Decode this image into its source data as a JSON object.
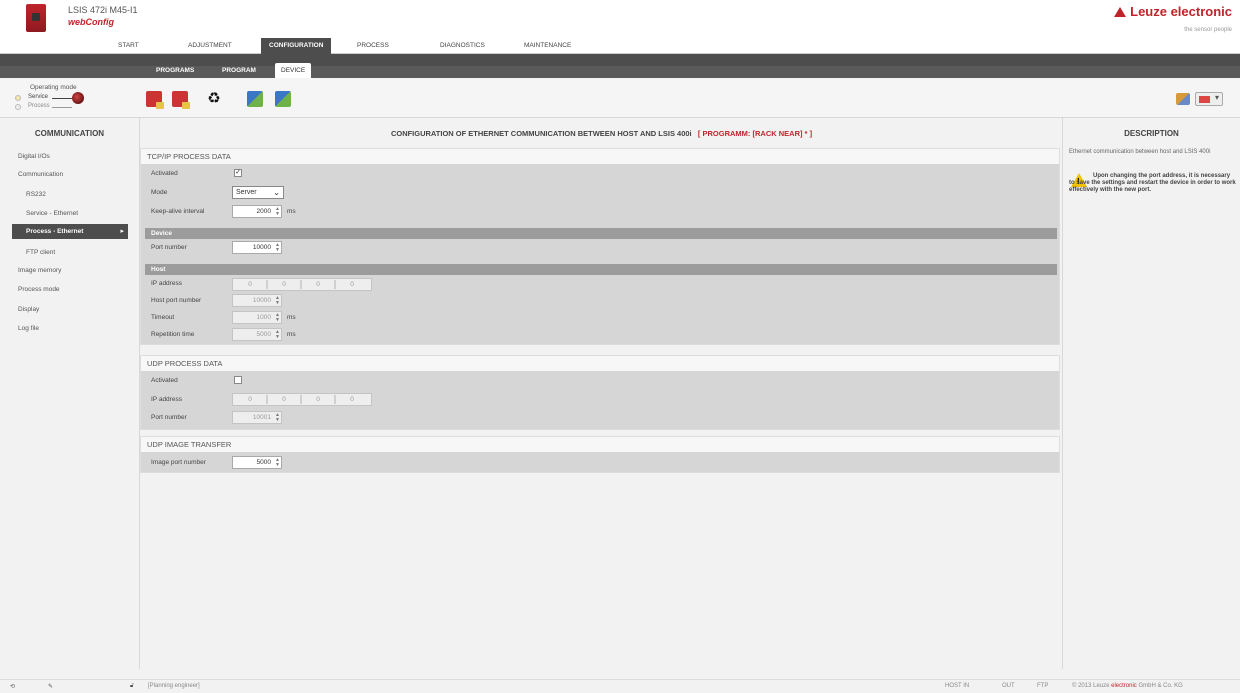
{
  "header": {
    "device_title": "LSIS 472i M45-I1",
    "app_name": "webConfig",
    "brand": "Leuze electronic",
    "tagline": "the sensor people"
  },
  "main_nav": [
    "START",
    "ADJUSTMENT",
    "CONFIGURATION",
    "PROCESS",
    "DIAGNOSTICS",
    "MAINTENANCE"
  ],
  "sub_nav": [
    "PROGRAMS",
    "PROGRAM",
    "DEVICE"
  ],
  "operating_mode": {
    "label": "Operating mode",
    "service": "Service",
    "process": "Process"
  },
  "sidebar": {
    "title": "COMMUNICATION",
    "items": [
      "Digital I/Os",
      "Communication",
      "RS232",
      "Service - Ethernet",
      "Process - Ethernet",
      "FTP client",
      "Image memory",
      "Process mode",
      "Display",
      "Log file"
    ]
  },
  "main": {
    "title": "CONFIGURATION OF ETHERNET COMMUNICATION BETWEEN HOST AND LSIS 400i",
    "program_ref": "[ PROGRAMM: [RACK NEAR] * ]",
    "tcpip": {
      "title": "TCP/IP PROCESS DATA",
      "activated_label": "Activated",
      "activated_mark": "✓",
      "mode_label": "Mode",
      "mode_value": "Server",
      "keepalive_label": "Keep-alive interval",
      "keepalive_value": "2000",
      "keepalive_unit": "ms",
      "device_header": "Device",
      "port_label": "Port number",
      "port_value": "10000",
      "host_header": "Host",
      "ip_label": "IP address",
      "ip": [
        "0",
        "0",
        "0",
        "0"
      ],
      "host_port_label": "Host port number",
      "host_port_value": "10000",
      "timeout_label": "Timeout",
      "timeout_value": "1000",
      "timeout_unit": "ms",
      "repetition_label": "Repetition time",
      "repetition_value": "5000",
      "repetition_unit": "ms"
    },
    "udp": {
      "title": "UDP PROCESS DATA",
      "activated_label": "Activated",
      "ip_label": "IP address",
      "ip": [
        "0",
        "0",
        "0",
        "0"
      ],
      "port_label": "Port number",
      "port_value": "10001"
    },
    "udp_image": {
      "title": "UDP IMAGE TRANSFER",
      "port_label": "Image port number",
      "port_value": "5000"
    }
  },
  "description": {
    "title": "DESCRIPTION",
    "text": "Ethernet communication between host and LSIS 400i",
    "warning": "Upon changing the port address, it is necessary to save the settings and restart the device in order to work effectively with the new port."
  },
  "footer": {
    "user": "[Planning engineer]",
    "status_host": "HOST IN",
    "status_out": "OUT",
    "status_ftp": "FTP",
    "copyright_prefix": "© 2013 Leuze",
    "copyright_brand": "electronic",
    "copyright_suffix": "GmbH & Co. KG"
  },
  "colors": {
    "accent": "#c0242b",
    "nav_dark": "#4d4d4d",
    "section_body": "#d6d6d6",
    "sub_header": "#9c9c9c",
    "warning": "#f2c200"
  }
}
